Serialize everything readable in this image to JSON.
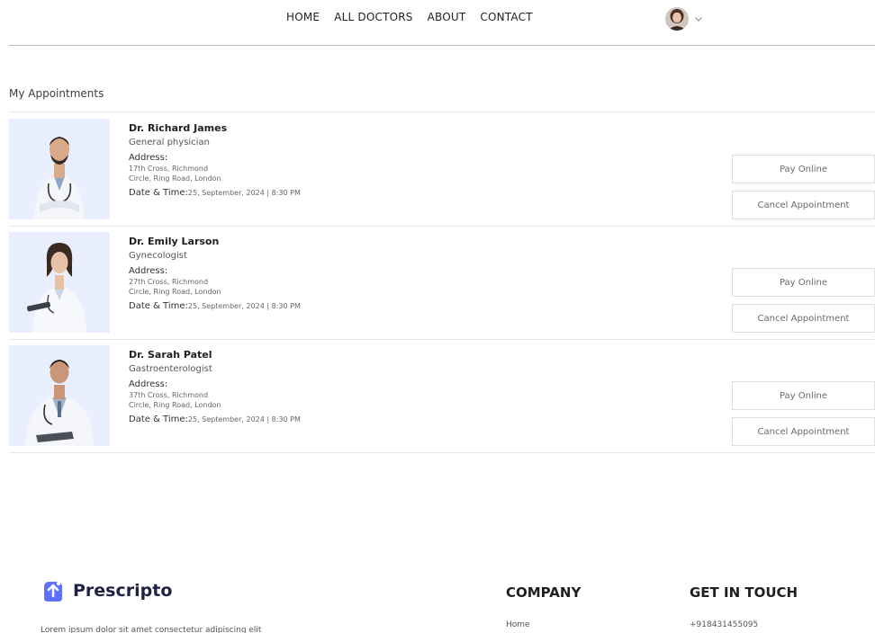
{
  "nav": {
    "links": [
      "HOME",
      "ALL DOCTORS",
      "ABOUT",
      "CONTACT"
    ]
  },
  "page": {
    "title": "My Appointments"
  },
  "appointments": [
    {
      "name": "Dr. Richard James",
      "speciality": "General physician",
      "address_label": "Address:",
      "address_line1": "17th Cross, Richmond",
      "address_line2": "Circle, Ring Road, London",
      "datetime_label": "Date & Time:",
      "datetime_value": "25, September, 2024 | 8:30 PM",
      "pay_label": "Pay Online",
      "cancel_label": "Cancel Appointment"
    },
    {
      "name": "Dr. Emily Larson",
      "speciality": "Gynecologist",
      "address_label": "Address:",
      "address_line1": "27th Cross, Richmond",
      "address_line2": "Circle, Ring Road, London",
      "datetime_label": "Date & Time:",
      "datetime_value": "25, September, 2024 | 8:30 PM",
      "pay_label": "Pay Online",
      "cancel_label": "Cancel Appointment"
    },
    {
      "name": "Dr. Sarah Patel",
      "speciality": "Gastroenterologist",
      "address_label": "Address:",
      "address_line1": "37th Cross, Richmond",
      "address_line2": "Circle, Ring Road, London",
      "datetime_label": "Date & Time:",
      "datetime_value": "25, September, 2024 | 8:30 PM",
      "pay_label": "Pay Online",
      "cancel_label": "Cancel Appointment"
    }
  ],
  "footer": {
    "brand": "Prescripto",
    "description": "Lorem ipsum dolor sit amet consectetur adipiscing elit",
    "company_heading": "COMPANY",
    "company_first_link": "Home",
    "contact_heading": "GET IN TOUCH",
    "phone": "+918431455095"
  },
  "colors": {
    "accent": "#5f6fff",
    "photo_bg": "#eaefff",
    "divider": "#e6e6e6"
  }
}
